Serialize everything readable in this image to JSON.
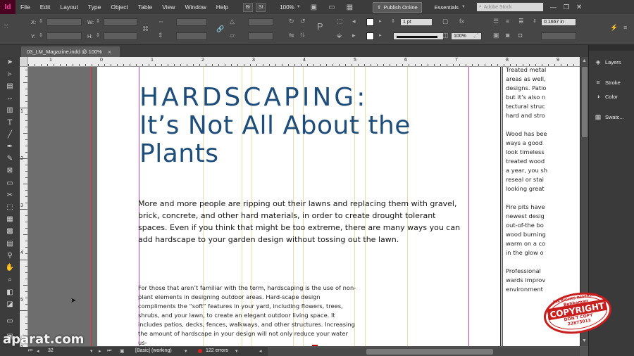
{
  "app": {
    "logo": "Id"
  },
  "menu": [
    "File",
    "Edit",
    "Layout",
    "Type",
    "Object",
    "Table",
    "View",
    "Window",
    "Help"
  ],
  "menubar": {
    "bridge": "Br",
    "stock": "St",
    "zoom": "100%",
    "publish": "Publish Online",
    "workspace": "Essentials",
    "search_placeholder": "Adobe Stock"
  },
  "control": {
    "x_label": "X:",
    "y_label": "Y:",
    "w_label": "W:",
    "h_label": "H:",
    "stroke_weight": "1 pt",
    "opacity": "100%",
    "gap": "0.1667 in"
  },
  "document": {
    "tab": "03_LM_Magazine.indd @ 100%",
    "close": "×"
  },
  "ruler": {
    "h_numbers": [
      "1",
      "0",
      "1",
      "2",
      "3",
      "4",
      "5",
      "6",
      "7",
      "8",
      "9",
      "10"
    ],
    "v_numbers": [
      "1",
      "2",
      "3",
      "4",
      "5",
      "6"
    ]
  },
  "article": {
    "headline_1": "HARDSCAPING:",
    "headline_2": "It’s Not All About the",
    "headline_3": "Plants",
    "intro": "More and more people are ripping out their lawns and replacing them with gravel, brick, concrete, and other hard materials, in order to create drought tolerant spaces. Even if you think that might be too extreme, there are many ways you can add hardscape to your garden design without tossing out the lawn.",
    "body": "For those that aren’t familiar with the term, hardscaping is the use of non-plant elements in designing outdoor areas. Hard-scape design compliments the “soft” features in your yard, including flowers, trees, shrubs, and your lawn, to create an elegant outdoor living space. It includes patios, decks, fences, walkways, and other structures. Increasing the amount of hardscape in your design will not only reduce your water us-",
    "col2_lines": [
      "Treated metal",
      "areas as well,",
      "designs. Patio",
      "but it’s also n",
      "tectural struc",
      "hard and stro",
      "",
      "Wood has bee",
      "ways a good",
      "look timeless",
      "treated wood",
      "a year, you sh",
      "reseal or stai",
      "looking great",
      "",
      "Fire pits have",
      "newest desig",
      "out-of-the bo",
      "wood burning",
      "warm on a co",
      "in the glow o",
      "",
      "Professional",
      "wards improv",
      "environment"
    ]
  },
  "panels": [
    "Layers",
    "Stroke",
    "Color",
    "Swatc..."
  ],
  "status": {
    "page": "32",
    "preflight_profile": "[Basic] (working)",
    "errors": "122 errors"
  },
  "watermark": {
    "aparat": "aparat.com",
    "stamp_top": "ALL RIGHTS RESERVED",
    "stamp_name": "Behkaman",
    "stamp_main": "COPYRIGHT",
    "stamp_sub": "DON'T COPY",
    "stamp_num": "22873013"
  },
  "colors": {
    "headline": "#1e4d7a",
    "accent_pink": "#ff3fa3",
    "margin_guide": "#c040c0",
    "column_guide": "#d8d070"
  }
}
